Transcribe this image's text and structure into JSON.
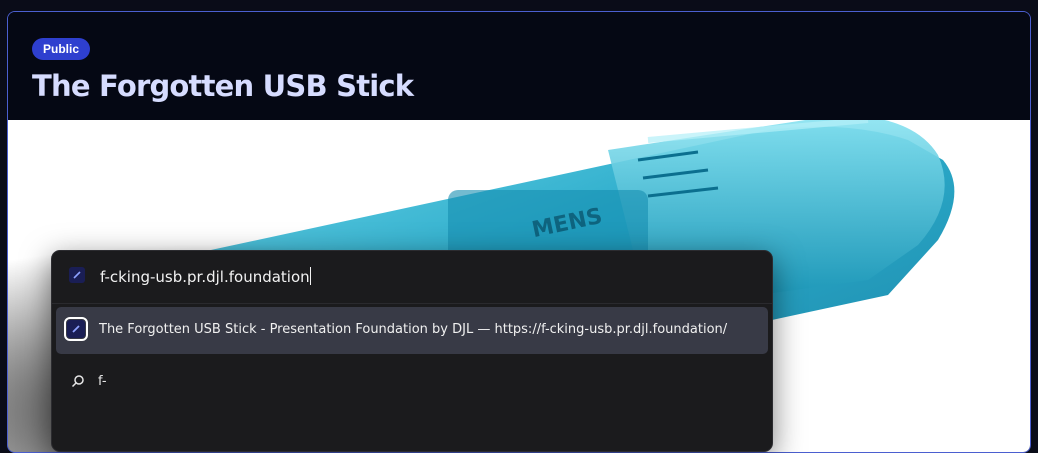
{
  "card": {
    "badge": "Public",
    "title": "The Forgotten USB Stick",
    "accent_color": "#2e3fcf",
    "border_color": "#4b5fd0"
  },
  "hero": {
    "image_icon": "usb-stick-photo",
    "device_label": "MENS"
  },
  "launcher": {
    "query": "f-cking-usb.pr.djl.foundation",
    "result_icon": "site-favicon-icon",
    "result_text": "The Forgotten USB Stick - Presentation Foundation by DJL — https://f-cking-usb.pr.djl.foundation/",
    "suggestion_icon": "search-icon",
    "suggestion_text": "f-"
  }
}
